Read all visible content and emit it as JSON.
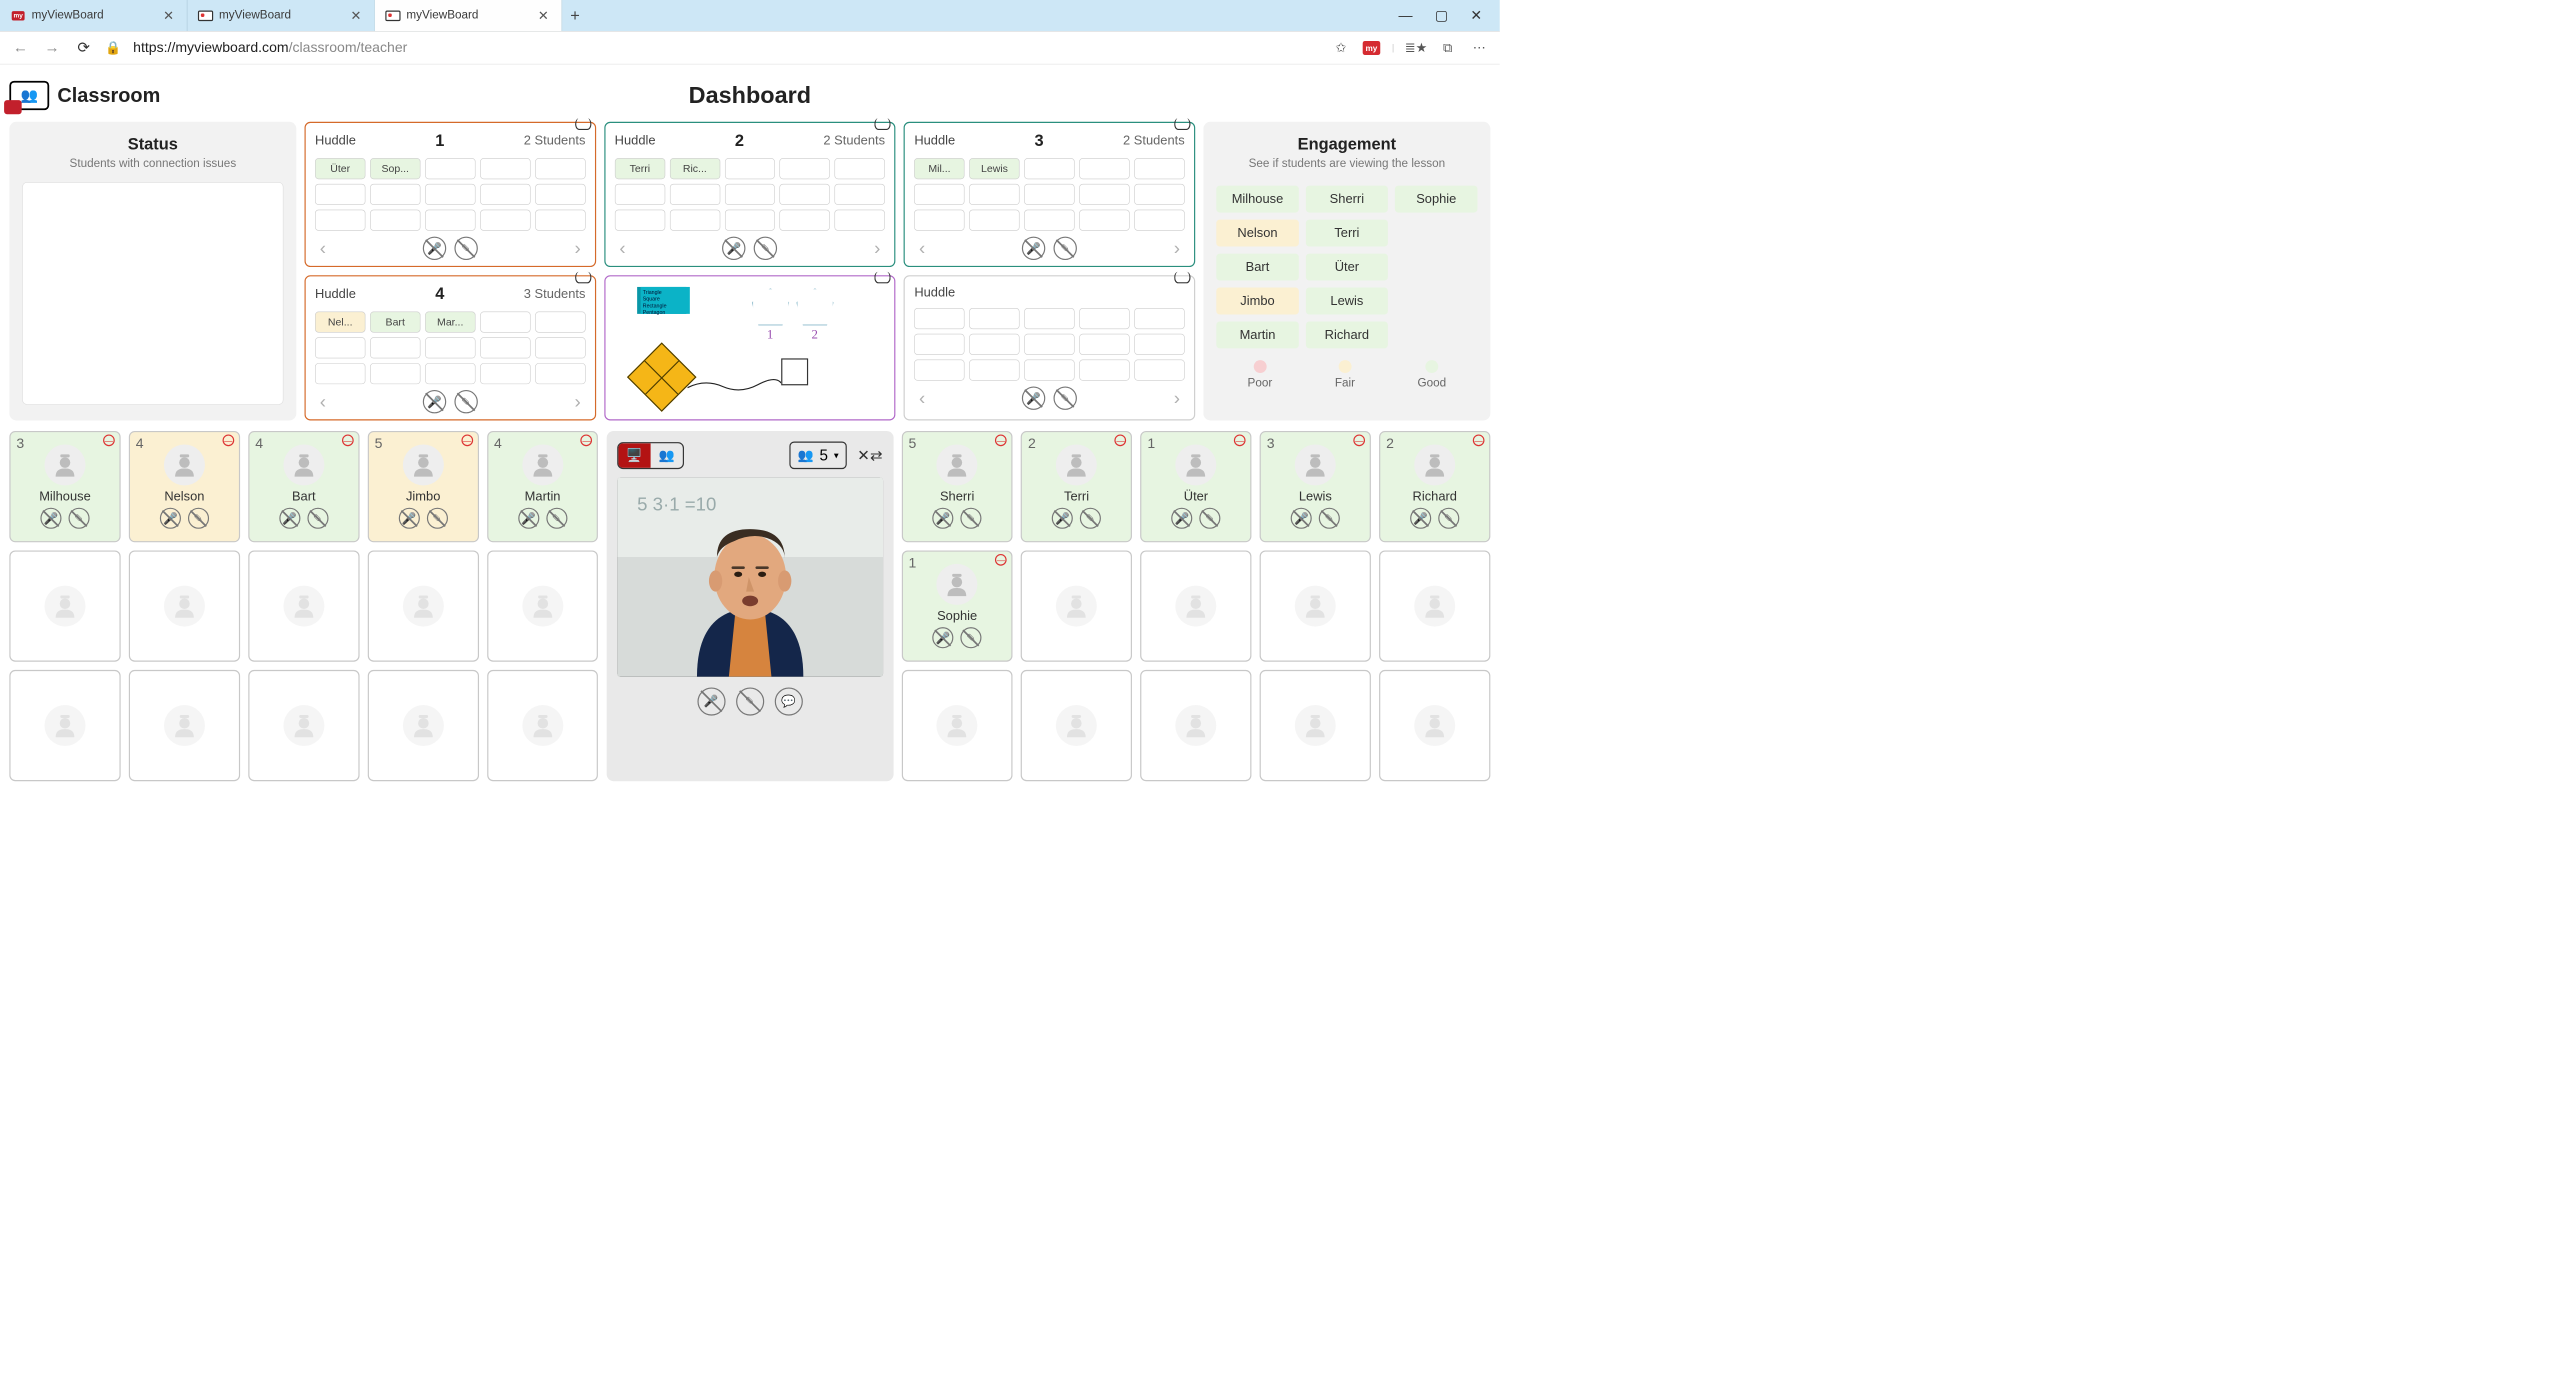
{
  "browser": {
    "tabs": [
      {
        "title": "myViewBoard",
        "active": false,
        "fav": "red"
      },
      {
        "title": "myViewBoard",
        "active": false,
        "fav": "cls"
      },
      {
        "title": "myViewBoard",
        "active": true,
        "fav": "cls"
      }
    ],
    "url_host": "https://myviewboard.com",
    "url_path": "/classroom/teacher"
  },
  "brand": "Classroom",
  "page_title": "Dashboard",
  "status": {
    "title": "Status",
    "subtitle": "Students with connection issues"
  },
  "huddles": [
    {
      "label": "Huddle",
      "num": "1",
      "count": "2 Students",
      "color": "c-orange",
      "students": [
        {
          "name": "Üter",
          "tone": "green"
        },
        {
          "name": "Sop...",
          "tone": "green"
        }
      ]
    },
    {
      "label": "Huddle",
      "num": "2",
      "count": "2 Students",
      "color": "c-teal",
      "students": [
        {
          "name": "Terri",
          "tone": "green"
        },
        {
          "name": "Ric...",
          "tone": "green"
        }
      ]
    },
    {
      "label": "Huddle",
      "num": "3",
      "count": "2 Students",
      "color": "c-teal",
      "students": [
        {
          "name": "Mil...",
          "tone": "green"
        },
        {
          "name": "Lewis",
          "tone": "green"
        }
      ]
    },
    {
      "label": "Huddle",
      "num": "4",
      "count": "3 Students",
      "color": "c-orange",
      "students": [
        {
          "name": "Nel...",
          "tone": "yellow"
        },
        {
          "name": "Bart",
          "tone": "green"
        },
        {
          "name": "Mar...",
          "tone": "green"
        }
      ]
    },
    {
      "type": "whiteboard",
      "sticky": [
        "Triangle",
        "Square",
        "Rectangle",
        "Pentagon"
      ],
      "nums": [
        "1",
        "2"
      ]
    },
    {
      "label": "Huddle",
      "num": "",
      "count": "",
      "color": "c-grey",
      "students": []
    }
  ],
  "engagement": {
    "title": "Engagement",
    "subtitle": "See if students are viewing the lesson",
    "chips": [
      {
        "name": "Milhouse",
        "tone": "green"
      },
      {
        "name": "Sherri",
        "tone": "green"
      },
      {
        "name": "Sophie",
        "tone": "green"
      },
      {
        "name": "Nelson",
        "tone": "yellow"
      },
      {
        "name": "Terri",
        "tone": "green"
      },
      {
        "name": "",
        "tone": "none"
      },
      {
        "name": "Bart",
        "tone": "green"
      },
      {
        "name": "Üter",
        "tone": "green"
      },
      {
        "name": "",
        "tone": "none"
      },
      {
        "name": "Jimbo",
        "tone": "yellow"
      },
      {
        "name": "Lewis",
        "tone": "green"
      },
      {
        "name": "",
        "tone": "none"
      },
      {
        "name": "Martin",
        "tone": "green"
      },
      {
        "name": "Richard",
        "tone": "green"
      },
      {
        "name": "",
        "tone": "none"
      }
    ],
    "legend": [
      {
        "label": "Poor",
        "cls": "d-pink"
      },
      {
        "label": "Fair",
        "cls": "d-yel"
      },
      {
        "label": "Good",
        "cls": "d-grn"
      }
    ]
  },
  "teacher": {
    "group_size": "5"
  },
  "students_left": [
    {
      "name": "Milhouse",
      "grp": "3",
      "tone": "green"
    },
    {
      "name": "Nelson",
      "grp": "4",
      "tone": "yellow"
    },
    {
      "name": "Bart",
      "grp": "4",
      "tone": "green"
    },
    {
      "name": "Jimbo",
      "grp": "5",
      "tone": "yellow"
    },
    {
      "name": "Martin",
      "grp": "4",
      "tone": "green"
    },
    {
      "name": "",
      "grp": "",
      "tone": "empty"
    },
    {
      "name": "",
      "grp": "",
      "tone": "empty"
    },
    {
      "name": "",
      "grp": "",
      "tone": "empty"
    },
    {
      "name": "",
      "grp": "",
      "tone": "empty"
    },
    {
      "name": "",
      "grp": "",
      "tone": "empty"
    },
    {
      "name": "",
      "grp": "",
      "tone": "empty"
    },
    {
      "name": "",
      "grp": "",
      "tone": "empty"
    },
    {
      "name": "",
      "grp": "",
      "tone": "empty"
    },
    {
      "name": "",
      "grp": "",
      "tone": "empty"
    },
    {
      "name": "",
      "grp": "",
      "tone": "empty"
    }
  ],
  "students_right": [
    {
      "name": "Sherri",
      "grp": "5",
      "tone": "green"
    },
    {
      "name": "Terri",
      "grp": "2",
      "tone": "green"
    },
    {
      "name": "Üter",
      "grp": "1",
      "tone": "green"
    },
    {
      "name": "Lewis",
      "grp": "3",
      "tone": "green"
    },
    {
      "name": "Richard",
      "grp": "2",
      "tone": "green"
    },
    {
      "name": "Sophie",
      "grp": "1",
      "tone": "green"
    },
    {
      "name": "",
      "grp": "",
      "tone": "empty"
    },
    {
      "name": "",
      "grp": "",
      "tone": "empty"
    },
    {
      "name": "",
      "grp": "",
      "tone": "empty"
    },
    {
      "name": "",
      "grp": "",
      "tone": "empty"
    },
    {
      "name": "",
      "grp": "",
      "tone": "empty"
    },
    {
      "name": "",
      "grp": "",
      "tone": "empty"
    },
    {
      "name": "",
      "grp": "",
      "tone": "empty"
    },
    {
      "name": "",
      "grp": "",
      "tone": "empty"
    },
    {
      "name": "",
      "grp": "",
      "tone": "empty"
    }
  ]
}
